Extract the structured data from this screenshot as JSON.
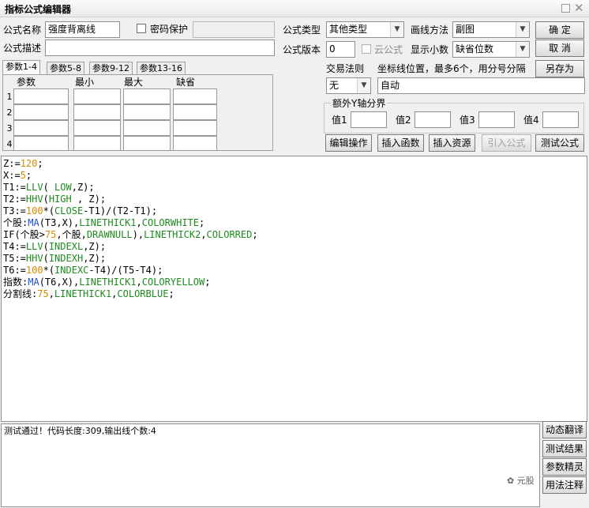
{
  "window": {
    "title": "指标公式编辑器"
  },
  "form": {
    "name_label": "公式名称",
    "name_value": "强度背离线",
    "password_label": "密码保护",
    "password_checked": false,
    "desc_label": "公式描述",
    "desc_value": "",
    "type_label": "公式类型",
    "type_value": "其他类型",
    "draw_label": "画线方法",
    "draw_value": "副图",
    "version_label": "公式版本",
    "version_value": "0",
    "cloud_label": "云公式",
    "cloud_checked": false,
    "decimals_label": "显示小数",
    "decimals_value": "缺省位数",
    "trade_label": "交易法则",
    "trade_value": "无",
    "axis_label": "坐标线位置，最多6个，用分号分隔",
    "axis_value": "自动",
    "extra_y_label": "额外Y轴分界",
    "extra_y_values": [
      "值1",
      "值2",
      "值3",
      "值4"
    ]
  },
  "buttons": {
    "ok": "确  定",
    "cancel": "取  消",
    "save_as": "另存为",
    "edit": "编辑操作",
    "insert_func": "插入函数",
    "insert_res": "插入资源",
    "import": "引入公式",
    "test": "测试公式"
  },
  "params": {
    "tabs": [
      "参数1-4",
      "参数5-8",
      "参数9-12",
      "参数13-16"
    ],
    "active_tab": 0,
    "headers": [
      "参数",
      "最小",
      "最大",
      "缺省"
    ],
    "rows": [
      "1",
      "2",
      "3",
      "4"
    ]
  },
  "code_lines": [
    [
      [
        "Z:=",
        ""
      ],
      [
        "120",
        "n"
      ],
      [
        ";",
        ""
      ]
    ],
    [
      [
        "X:=",
        ""
      ],
      [
        "5",
        "n"
      ],
      [
        ";",
        ""
      ]
    ],
    [
      [
        "T1:=",
        ""
      ],
      [
        "LLV",
        "f"
      ],
      [
        "( ",
        ""
      ],
      [
        "LOW",
        "f"
      ],
      [
        ",Z);",
        ""
      ]
    ],
    [
      [
        "T2:=",
        ""
      ],
      [
        "HHV",
        "f"
      ],
      [
        "(",
        ""
      ],
      [
        "HIGH",
        "f"
      ],
      [
        " , Z);",
        ""
      ]
    ],
    [
      [
        "T3:=",
        ""
      ],
      [
        "100",
        "n"
      ],
      [
        "*(",
        ""
      ],
      [
        "CLOSE",
        "f"
      ],
      [
        "-T1)/(T2-T1);",
        ""
      ]
    ],
    [
      [
        "个股:",
        ""
      ],
      [
        "MA",
        "c"
      ],
      [
        "(T3,X),",
        ""
      ],
      [
        "LINETHICK1",
        "f"
      ],
      [
        ",",
        ""
      ],
      [
        "COLORWHITE",
        "f"
      ],
      [
        ";",
        ""
      ]
    ],
    [
      [
        "IF(个股>",
        ""
      ],
      [
        "75",
        "n"
      ],
      [
        ",个股,",
        ""
      ],
      [
        "DRAWNULL",
        "f"
      ],
      [
        "),",
        ""
      ],
      [
        "LINETHICK2",
        "f"
      ],
      [
        ",",
        ""
      ],
      [
        "COLORRED",
        "f"
      ],
      [
        ";",
        ""
      ]
    ],
    [
      [
        "T4:=",
        ""
      ],
      [
        "LLV",
        "f"
      ],
      [
        "(",
        ""
      ],
      [
        "INDEXL",
        "f"
      ],
      [
        ",Z);",
        ""
      ]
    ],
    [
      [
        "T5:=",
        ""
      ],
      [
        "HHV",
        "f"
      ],
      [
        "(",
        ""
      ],
      [
        "INDEXH",
        "f"
      ],
      [
        ",Z);",
        ""
      ]
    ],
    [
      [
        "T6:=",
        ""
      ],
      [
        "100",
        "n"
      ],
      [
        "*(",
        ""
      ],
      [
        "INDEXC",
        "f"
      ],
      [
        "-T4)/(T5-T4);",
        ""
      ]
    ],
    [
      [
        "指数:",
        ""
      ],
      [
        "MA",
        "c"
      ],
      [
        "(T6,X),",
        ""
      ],
      [
        "LINETHICK1",
        "f"
      ],
      [
        ",",
        ""
      ],
      [
        "COLORYELLOW",
        "f"
      ],
      [
        ";",
        ""
      ]
    ],
    [
      [
        "分割线:",
        ""
      ],
      [
        "75",
        "n"
      ],
      [
        ",",
        ""
      ],
      [
        "LINETHICK1",
        "f"
      ],
      [
        ",",
        ""
      ],
      [
        "COLORBLUE",
        "f"
      ],
      [
        ";",
        ""
      ]
    ]
  ],
  "status": {
    "message": "测试通过！代码长度:309,输出线个数:4"
  },
  "side_buttons": [
    "动态翻译",
    "测试结果",
    "参数精灵",
    "用法注释"
  ],
  "watermark": "元股"
}
